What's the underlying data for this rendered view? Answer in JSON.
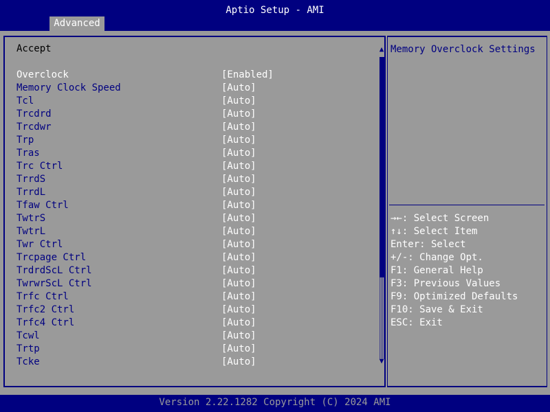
{
  "header": {
    "title": "Aptio Setup - AMI",
    "tabs": [
      {
        "label": "Advanced"
      }
    ]
  },
  "menu": {
    "heading": "Accept",
    "items": [
      {
        "label": "Overclock",
        "value": "[Enabled]",
        "selected": true
      },
      {
        "label": "Memory Clock Speed",
        "value": "[Auto]"
      },
      {
        "label": "Tcl",
        "value": "[Auto]"
      },
      {
        "label": "Trcdrd",
        "value": "[Auto]"
      },
      {
        "label": "Trcdwr",
        "value": "[Auto]"
      },
      {
        "label": "Trp",
        "value": "[Auto]"
      },
      {
        "label": "Tras",
        "value": "[Auto]"
      },
      {
        "label": "Trc Ctrl",
        "value": "[Auto]"
      },
      {
        "label": "TrrdS",
        "value": "[Auto]"
      },
      {
        "label": "TrrdL",
        "value": "[Auto]"
      },
      {
        "label": "Tfaw Ctrl",
        "value": "[Auto]"
      },
      {
        "label": "TwtrS",
        "value": "[Auto]"
      },
      {
        "label": "TwtrL",
        "value": "[Auto]"
      },
      {
        "label": "Twr Ctrl",
        "value": "[Auto]"
      },
      {
        "label": "Trcpage Ctrl",
        "value": "[Auto]"
      },
      {
        "label": "TrdrdScL Ctrl",
        "value": "[Auto]"
      },
      {
        "label": "TwrwrScL Ctrl",
        "value": "[Auto]"
      },
      {
        "label": "Trfc Ctrl",
        "value": "[Auto]"
      },
      {
        "label": "Trfc2 Ctrl",
        "value": "[Auto]"
      },
      {
        "label": "Trfc4 Ctrl",
        "value": "[Auto]"
      },
      {
        "label": "Tcwl",
        "value": "[Auto]"
      },
      {
        "label": "Trtp",
        "value": "[Auto]"
      },
      {
        "label": "Tcke",
        "value": "[Auto]"
      }
    ]
  },
  "scrollbar": {
    "up_glyph": "▲",
    "down_glyph": "▼",
    "position": 0.0,
    "visible_fraction": 0.73
  },
  "help": {
    "title": "Memory Overclock Settings",
    "keys": [
      "→←: Select Screen",
      "↑↓: Select Item",
      "Enter: Select",
      "+/-: Change Opt.",
      "F1: General Help",
      "F3: Previous Values",
      "F9: Optimized Defaults",
      "F10: Save & Exit",
      "ESC: Exit"
    ]
  },
  "footer": {
    "text": "Version 2.22.1282 Copyright (C) 2024 AMI"
  },
  "colors": {
    "background": "#000080",
    "panel": "#9a9a9a",
    "highlight_text": "#ffffff",
    "label_text": "#000080"
  }
}
